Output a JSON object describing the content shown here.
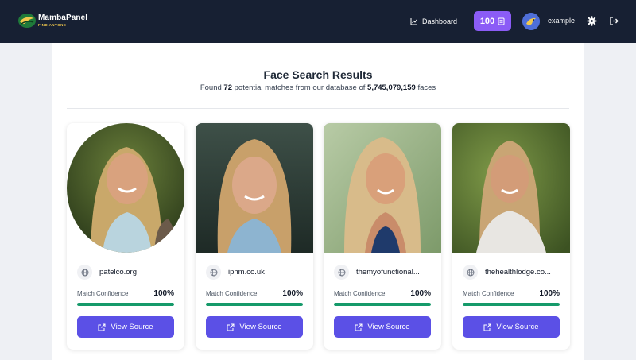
{
  "header": {
    "brand": "MambaPanel",
    "tagline": "FIND ANYONE",
    "dashboard_label": "Dashboard",
    "credits": "100",
    "username": "example"
  },
  "results": {
    "title": "Face Search Results",
    "found_prefix": "Found",
    "match_count": "72",
    "found_middle": "potential matches from our database of",
    "database_size": "5,745,079,159",
    "found_suffix": "faces"
  },
  "cards": [
    {
      "site": "patelco.org",
      "confidence_label": "Match Confidence",
      "confidence": "100%",
      "confidence_fraction": 1.0,
      "button": "View Source"
    },
    {
      "site": "iphm.co.uk",
      "confidence_label": "Match Confidence",
      "confidence": "100%",
      "confidence_fraction": 1.0,
      "button": "View Source"
    },
    {
      "site": "themyofunctional...",
      "confidence_label": "Match Confidence",
      "confidence": "100%",
      "confidence_fraction": 1.0,
      "button": "View Source"
    },
    {
      "site": "thehealthlodge.co...",
      "confidence_label": "Match Confidence",
      "confidence": "100%",
      "confidence_fraction": 1.0,
      "button": "View Source"
    }
  ],
  "colors": {
    "nav_bg": "#172033",
    "accent_purple": "#8b5cf6",
    "button_indigo": "#5b50e6",
    "confidence_green": "#159a6a"
  },
  "icons": [
    "logo-icon",
    "chart-line-icon",
    "coins-icon",
    "avatar",
    "gear-icon",
    "logout-icon",
    "globe-icon",
    "external-link-icon"
  ]
}
